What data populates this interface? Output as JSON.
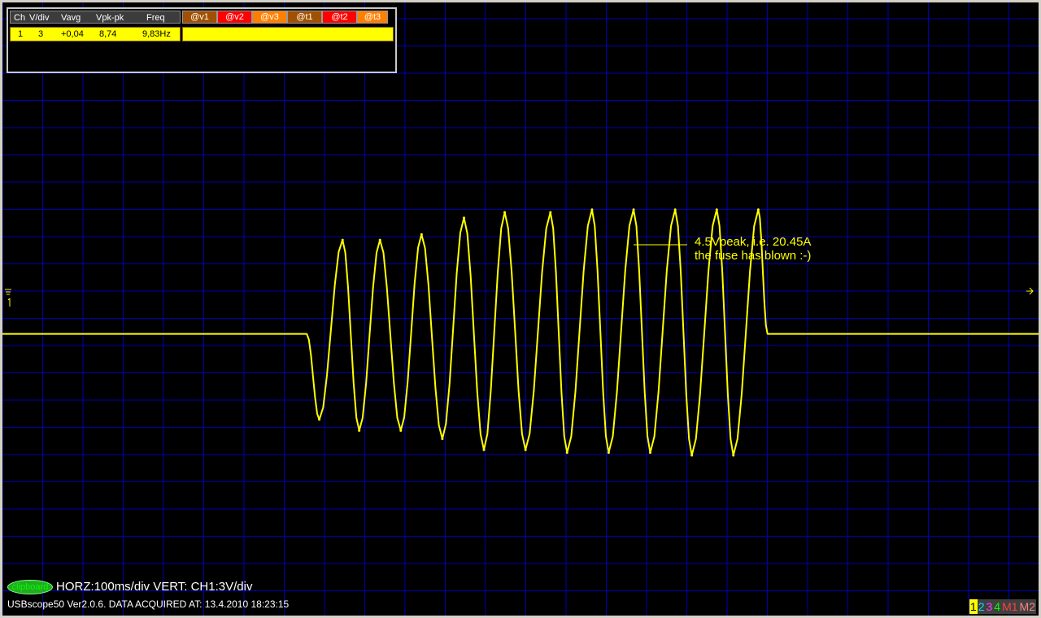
{
  "measurements": {
    "headers": {
      "ch": "Ch",
      "vdiv": "V/div",
      "vavg": "Vavg",
      "vpkpk": "Vpk-pk",
      "freq": "Freq"
    },
    "cursor_buttons": [
      {
        "label": "@v1",
        "color": "#a05000"
      },
      {
        "label": "@v2",
        "color": "#ff0000"
      },
      {
        "label": "@v3",
        "color": "#ff8000"
      },
      {
        "label": "@t1",
        "color": "#a05000"
      },
      {
        "label": "@t2",
        "color": "#ff0000"
      },
      {
        "label": "@t3",
        "color": "#ff8000"
      }
    ],
    "row": {
      "ch": "1",
      "vdiv": "3",
      "vavg": "+0,04",
      "vpkpk": "8,74",
      "freq": "9,83Hz"
    }
  },
  "annotation": {
    "line1": "4.5Vpeak, i.e. 20.45A",
    "line2": "the fuse has blown :-)"
  },
  "footer": {
    "clipboard_label": "clipboard",
    "scale_text": "HORZ:100ms/div VERT: CH1:3V/div",
    "status_text": "USBscope50 Ver2.0.6.  DATA ACQUIRED AT: 13.4.2010 18:23:15"
  },
  "channel_selector": [
    {
      "label": "1",
      "fg": "#000000",
      "bg": "#ffff00"
    },
    {
      "label": "2",
      "fg": "#00e0ff",
      "bg": "#404040"
    },
    {
      "label": "3",
      "fg": "#ff40ff",
      "bg": "#404040"
    },
    {
      "label": "4",
      "fg": "#00ff00",
      "bg": "#404040"
    },
    {
      "label": "M1",
      "fg": "#ff4040",
      "bg": "#404040"
    },
    {
      "label": "M2",
      "fg": "#ff8080",
      "bg": "#404040"
    }
  ],
  "colors": {
    "trace": "#ffff00",
    "grid": "#0000b0",
    "background": "#000000"
  },
  "chart_data": {
    "type": "line",
    "title": "",
    "xlabel": "",
    "ylabel": "",
    "horizontal_scale": "100ms/div",
    "vertical_scale": "3V/div",
    "grid": true,
    "x_unit": "ms",
    "y_unit": "V",
    "xlim": [
      0,
      1250
    ],
    "ylim": [
      -10.2,
      12.0
    ],
    "series": [
      {
        "name": "CH1",
        "color": "#ffff00",
        "burst_start_ms": 368,
        "burst_end_ms": 922,
        "frequency_hz": 9.83,
        "peaks": [
          {
            "t": 411,
            "v": 3.4
          },
          {
            "t": 456,
            "v": 3.4
          },
          {
            "t": 506,
            "v": 3.6
          },
          {
            "t": 557,
            "v": 4.2
          },
          {
            "t": 606,
            "v": 4.4
          },
          {
            "t": 661,
            "v": 4.4
          },
          {
            "t": 711,
            "v": 4.5
          },
          {
            "t": 761,
            "v": 4.5
          },
          {
            "t": 811,
            "v": 4.5
          },
          {
            "t": 861,
            "v": 4.5
          },
          {
            "t": 911,
            "v": 4.5
          }
        ],
        "troughs": [
          {
            "t": 383,
            "v": -3.1
          },
          {
            "t": 431,
            "v": -3.5
          },
          {
            "t": 481,
            "v": -3.5
          },
          {
            "t": 531,
            "v": -3.8
          },
          {
            "t": 581,
            "v": -4.2
          },
          {
            "t": 631,
            "v": -4.2
          },
          {
            "t": 681,
            "v": -4.3
          },
          {
            "t": 731,
            "v": -4.3
          },
          {
            "t": 781,
            "v": -4.3
          },
          {
            "t": 831,
            "v": -4.4
          },
          {
            "t": 881,
            "v": -4.4
          }
        ]
      }
    ]
  }
}
